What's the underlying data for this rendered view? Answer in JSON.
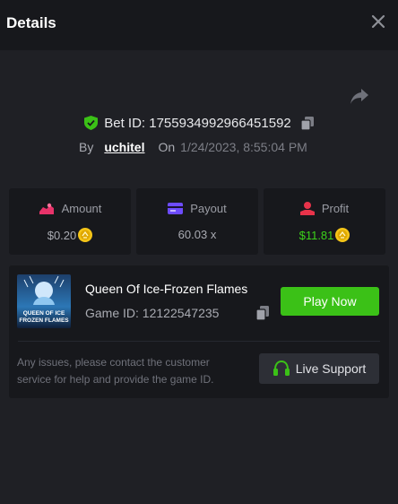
{
  "header": {
    "title": "Details",
    "close_icon": "close-icon"
  },
  "bet": {
    "id_label": "Bet ID: 1755934992966451592",
    "by_label": "By",
    "username": "uchitel",
    "on_label": "On",
    "date": "1/24/2023, 8:55:04 PM"
  },
  "stats": {
    "amount": {
      "label": "Amount",
      "value": "$0.20",
      "icon": "amount-icon"
    },
    "payout": {
      "label": "Payout",
      "value": "60.03 x",
      "icon": "payout-card-icon"
    },
    "profit": {
      "label": "Profit",
      "value": "$11.81",
      "icon": "profit-icon"
    }
  },
  "game": {
    "name": "Queen Of Ice-Frozen Flames",
    "id_label": "Game ID: 12122547235",
    "play_label": "Play Now",
    "thumb_text_line1": "QUEEN OF ICE",
    "thumb_text_line2": "FROZEN FLAMES"
  },
  "support": {
    "text": "Any issues, please contact the customer service for help and provide the game ID.",
    "button_label": "Live Support"
  },
  "colors": {
    "accent_green": "#3bc117",
    "profit_green": "#3cd21a",
    "amount_pink": "#e8336a",
    "payout_purple": "#6d4cff",
    "profit_red": "#e8334a"
  }
}
